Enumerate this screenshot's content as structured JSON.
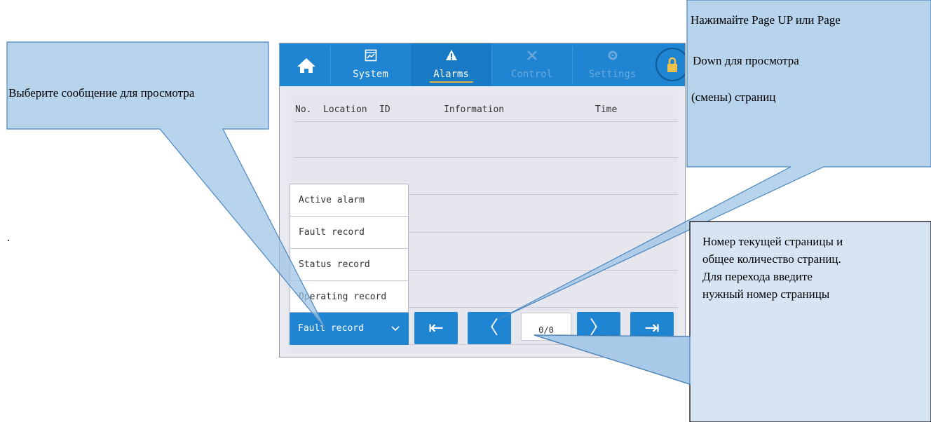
{
  "device": {
    "tabs": [
      {
        "label": "System",
        "icon": "chart-monitor-icon",
        "state": "normal"
      },
      {
        "label": "Alarms",
        "icon": "warning-icon",
        "state": "active"
      },
      {
        "label": "Control",
        "icon": "tools-icon",
        "state": "disabled"
      },
      {
        "label": "Settings",
        "icon": "gear-icon",
        "state": "disabled"
      }
    ],
    "table_headers": {
      "no": "No.",
      "location": "Location",
      "id": "ID",
      "information": "Information",
      "time": "Time"
    },
    "dropdown_options": [
      "Active alarm",
      "Fault record",
      "Status record",
      "Operating record"
    ],
    "dropdown_selected": "Fault record",
    "page_indicator": "0/0",
    "nav": {
      "first": "⇤",
      "prev": "〈",
      "next": "〉",
      "last": "⇥"
    }
  },
  "callouts": {
    "left": "Выберите сообщение для просмотра",
    "top_right": [
      "Нажимайте Page UP или Page",
      "Down для просмотра",
      "(смены) страниц"
    ],
    "bottom_right": [
      "Номер текущей страницы и",
      "общее количество страниц.",
      "Для перехода введите",
      "нужный номер страницы"
    ],
    "stray_dot": "."
  },
  "colors": {
    "accent": "#1f84d1",
    "callout_fill": "#9cc2e5",
    "callout_fill_light": "#d6e4f4"
  }
}
